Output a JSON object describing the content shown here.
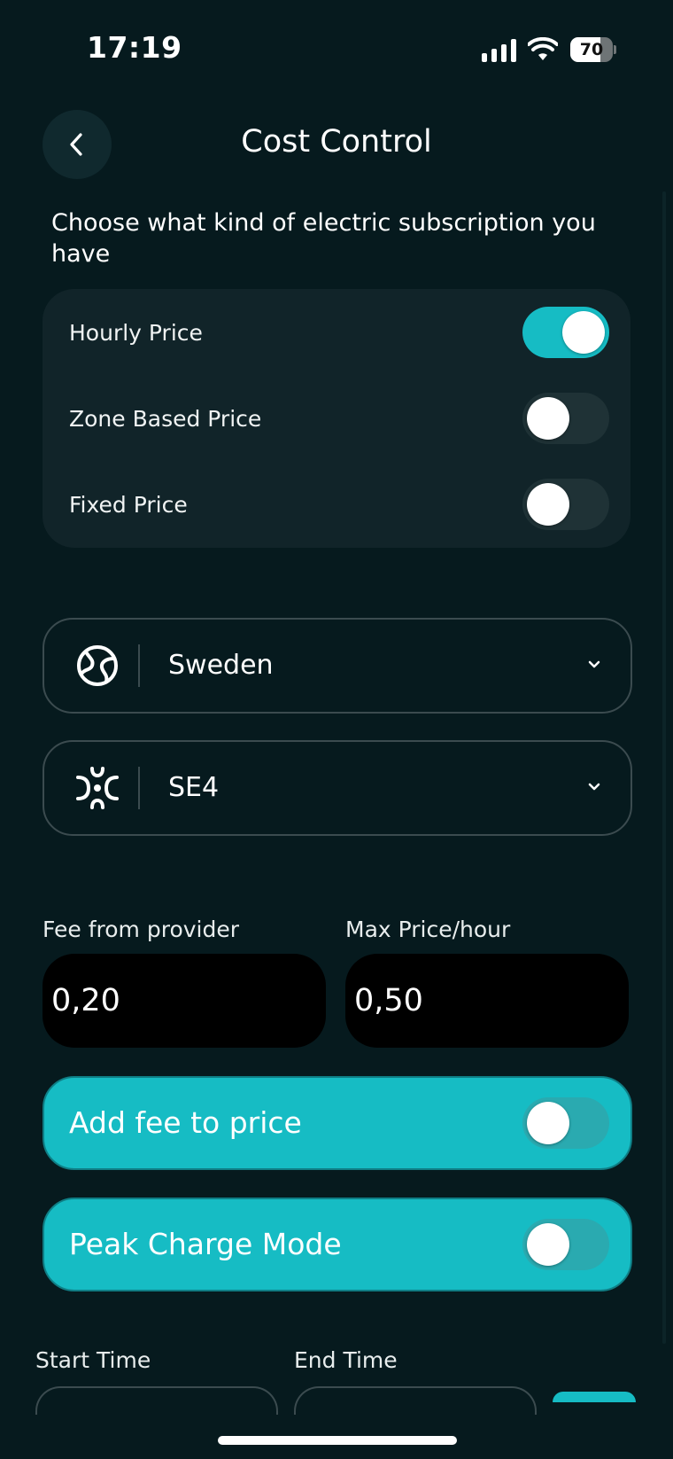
{
  "status_bar": {
    "time": "17:19",
    "battery": "70",
    "battery_level": 0.7
  },
  "header": {
    "title": "Cost Control"
  },
  "subtitle": "Choose what kind of electric subscription you have",
  "subscription_options": [
    {
      "label": "Hourly Price",
      "on": true
    },
    {
      "label": "Zone Based Price",
      "on": false
    },
    {
      "label": "Fixed Price",
      "on": false
    }
  ],
  "country_select": {
    "value": "Sweden",
    "icon": "globe-icon"
  },
  "zone_select": {
    "value": "SE4",
    "icon": "zone-icon"
  },
  "fees": {
    "provider_fee_label": "Fee from provider",
    "provider_fee_value": "0,20",
    "max_price_label": "Max Price/hour",
    "max_price_value": "0,50"
  },
  "add_fee": {
    "label": "Add fee to price",
    "on": false
  },
  "peak_mode": {
    "label": "Peak Charge Mode",
    "on": false
  },
  "schedule": {
    "start_label": "Start Time",
    "end_label": "End Time"
  },
  "colors": {
    "background": "#061a1e",
    "card": "#112429",
    "accent": "#16bcc4"
  }
}
